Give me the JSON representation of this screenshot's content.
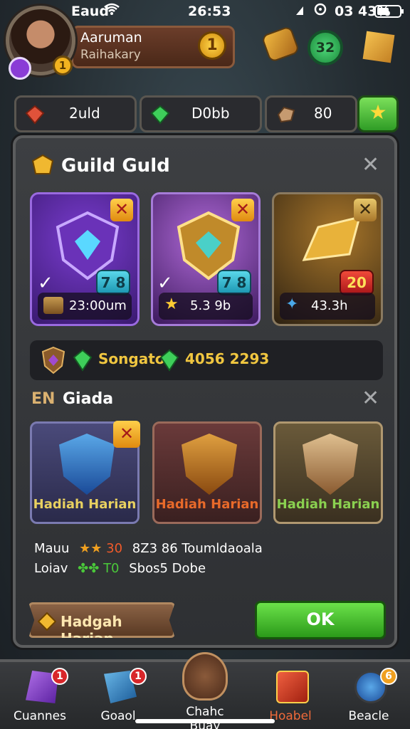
{
  "status_bar": {
    "carrier": "Eaud",
    "time": "26:53",
    "battery": "03 43%"
  },
  "header": {
    "player_name": "Aaruman",
    "player_subtitle": "Raihakary",
    "level_badge": "1",
    "coin_value": "1",
    "gem_count": "32"
  },
  "currencies": [
    {
      "icon": "red-crystal-icon",
      "value": "2uld"
    },
    {
      "icon": "green-gem-icon",
      "value": "D0bb"
    },
    {
      "icon": "ore-icon",
      "value": "80"
    }
  ],
  "panel": {
    "title": "Guild Guld",
    "cards": [
      {
        "level": "7 8",
        "label": "23:00um",
        "theme": "purple",
        "badge_color": "#3fc4de"
      },
      {
        "level": "7 8",
        "label": "5.3 9b",
        "theme": "violet",
        "badge_color": "#3fc4de"
      },
      {
        "level": "20",
        "label": "43.3h",
        "theme": "gold",
        "badge_color": "#d8262a"
      }
    ],
    "info_text": "Songato",
    "info_value": "4056 2293",
    "section2_title": "Giada",
    "section2_prefix": "EN",
    "rewards": [
      {
        "label": "Hadiah Harian",
        "theme": "blue"
      },
      {
        "label": "Hadiah Harian",
        "theme": "red"
      },
      {
        "label": "Hadiah Harian",
        "theme": "gold"
      }
    ],
    "row1": {
      "label": "Mauu",
      "stars": "30",
      "text": "8Z3 86 Toumldaoala"
    },
    "row2": {
      "label": "Loiav",
      "clovers": "T0",
      "text": "Sbos5 Dobe"
    },
    "left_button": "Hadgah Harian",
    "ok_button": "OK"
  },
  "nav": [
    {
      "label": "Cuannes",
      "badge": "1",
      "icon": "purple-gem-icon"
    },
    {
      "label": "Goaol",
      "badge": "1",
      "icon": "blue-gem-icon"
    },
    {
      "label": "Chahc Buay",
      "badge": "",
      "icon": "guild-shield-icon"
    },
    {
      "label": "Hoabel",
      "badge": "",
      "icon": "red-chest-icon"
    },
    {
      "label": "Beacle",
      "badge": "6",
      "icon": "blue-box-icon"
    }
  ]
}
